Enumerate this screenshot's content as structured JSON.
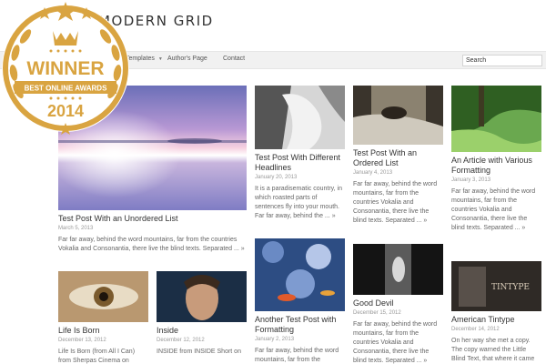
{
  "header": {
    "site_title": "MODERN GRID"
  },
  "nav": {
    "items": [
      "Templates",
      "Author's Page",
      "Contact"
    ],
    "search_value": "Search"
  },
  "badge": {
    "word": "WINNER",
    "subtitle": "BEST ONLINE AWARDS",
    "year": "2014"
  },
  "posts": [
    {
      "title": "Test Post With an Unordered List",
      "date": "March 5, 2013",
      "excerpt": "Far far away, behind the word mountains, far from the countries Vokalia and Consonantia, there live the blind texts. Separated ... »"
    },
    {
      "title": "Test Post With Different Headlines",
      "date": "January 20, 2013",
      "excerpt": "It is a paradisematic country, in which roasted parts of sentences fly into your mouth. Far far away, behind the ... »"
    },
    {
      "title": "Test Post With an Ordered List",
      "date": "January 4, 2013",
      "excerpt": "Far far away, behind the word mountains, far from the countries Vokalia and Consonantia, there live the blind texts. Separated ... »"
    },
    {
      "title": "An Article with Various Formatting",
      "date": "January 3, 2013",
      "excerpt": "Far far away, behind the word mountains, far from the countries Vokalia and Consonantia, there live the blind texts. Separated ... »"
    },
    {
      "title": "Life Is Born",
      "date": "December 13, 2012",
      "excerpt": "Life Is Born (from All I Can) from Sherpas Cinema on Vimeo. On"
    },
    {
      "title": "Inside",
      "date": "December 12, 2012",
      "excerpt": "INSIDE from INSIDE Short on"
    },
    {
      "title": "Another Test Post with Formatting",
      "date": "January 2, 2013",
      "excerpt": "Far far away, behind the word mountains, far from the"
    },
    {
      "title": "Good Devil",
      "date": "December 15, 2012",
      "excerpt": "Far far away, behind the word mountains, far from the countries Vokalia and Consonantia, there live the blind texts. Separated ... »"
    },
    {
      "title": "American Tintype",
      "date": "December 14, 2012",
      "excerpt": "On her way she met a copy. The copy warned the Little Blind Text, that where it came from it"
    }
  ],
  "thumb_labels": {
    "tintype": "TINTYPE"
  },
  "colors": {
    "navbar": "#f1f1f1",
    "badge_gold": "#d9a441",
    "text": "#333333"
  }
}
